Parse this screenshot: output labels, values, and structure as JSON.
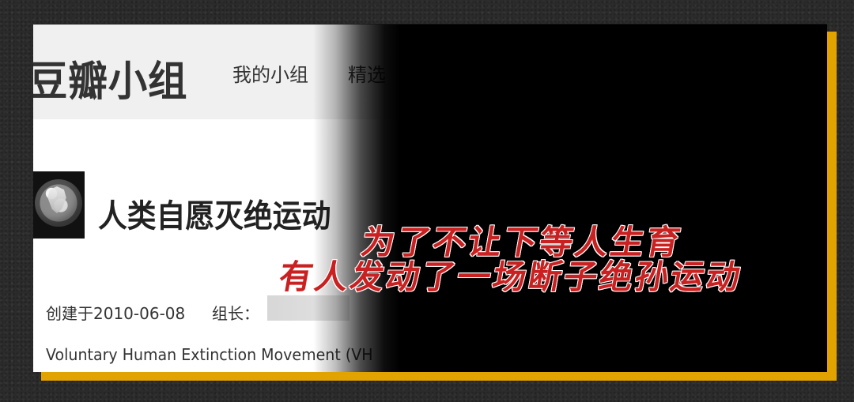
{
  "screen": {
    "header": {
      "title": "豆瓣小组",
      "nav": [
        {
          "label": "我的小组"
        },
        {
          "label": "精选"
        }
      ]
    },
    "group": {
      "name": "人类自愿灭绝运动",
      "created": "创建于2010-06-08",
      "owner_label": "组长：",
      "description": "Voluntary Human Extinction Movement (VH"
    }
  },
  "captions": {
    "line1": "为了不让下等人生育",
    "line2": "有人发动了一场断子绝孙运动"
  },
  "colors": {
    "frame_accent": "#e0a300",
    "caption_red": "#c92121"
  }
}
